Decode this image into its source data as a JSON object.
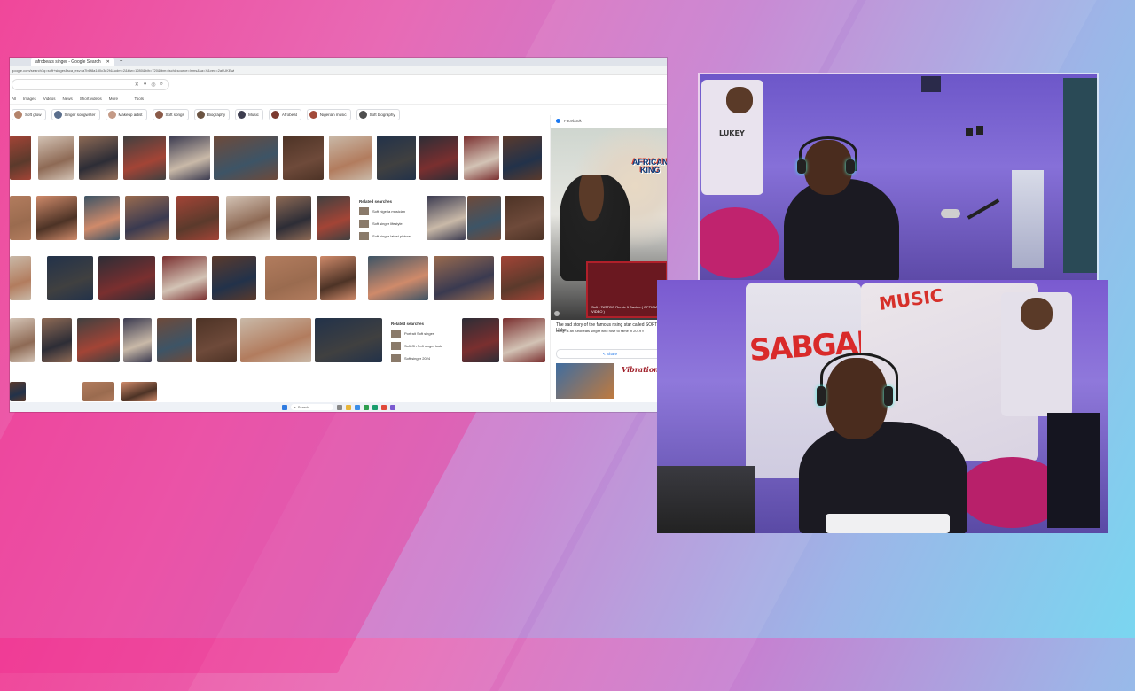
{
  "browser": {
    "tab_title": "afrobeats singer - Google Search",
    "address": "google.com/search?q=soft+singer&sca_esv=a7b6f8a1d0c3e2f4&udm=2&biw=1280&bih=720&tbm=isch&source=lnms&sa=X&ved=2ahUKEwi",
    "filters": [
      "All",
      "Images",
      "Videos",
      "News",
      "Short videos",
      "More"
    ],
    "tools_label": "Tools",
    "chips": [
      {
        "label": "Soft glow",
        "color": "#b4836a"
      },
      {
        "label": "Singer songwriter",
        "color": "#5a6e8c"
      },
      {
        "label": "Makeup artist",
        "color": "#c49a86"
      },
      {
        "label": "Soft songs",
        "color": "#8a5a48"
      },
      {
        "label": "Biography",
        "color": "#6b5442"
      },
      {
        "label": "Music",
        "color": "#3e3e50"
      },
      {
        "label": "Afrobeat",
        "color": "#7c3b30"
      },
      {
        "label": "Nigerian music",
        "color": "#a24a3a"
      },
      {
        "label": "Soft biography",
        "color": "#4e4e4e"
      }
    ],
    "related_1": {
      "title": "Related searches",
      "items": [
        "Soft nigeria musician",
        "Soft singer lifestyle",
        "Soft singer latest picture"
      ]
    },
    "related_2": {
      "title": "Related searches",
      "items": [
        "Portrait Soft singer",
        "Soft Oh Soft singer look",
        "Soft singer 2024"
      ]
    },
    "side_panel": {
      "source": "Facebook",
      "logo_line1": "AFRICAN",
      "logo_line2": "KING",
      "video_caption": "Soft - TATTOO Remix ft Davido ( OFFICIAL VIDEO )",
      "title": "The sad story of the famous rising star called SOFT, Uche",
      "description": "Bang! is an Afrobeats singer who rose to fame in 2019 !!",
      "share_label": "Share",
      "vibrations_label": "Vibrations"
    },
    "taskbar_search": "Search"
  },
  "cams": {
    "bottom_mural_text": "SABGANG",
    "bottom_music_text": "MUSIC",
    "top_tshirt_text": "LUKEY"
  },
  "colors": {
    "accent_pink": "#f0479a",
    "accent_cyan": "#7ad6f0",
    "cam_purple": "#7a5ad0"
  }
}
